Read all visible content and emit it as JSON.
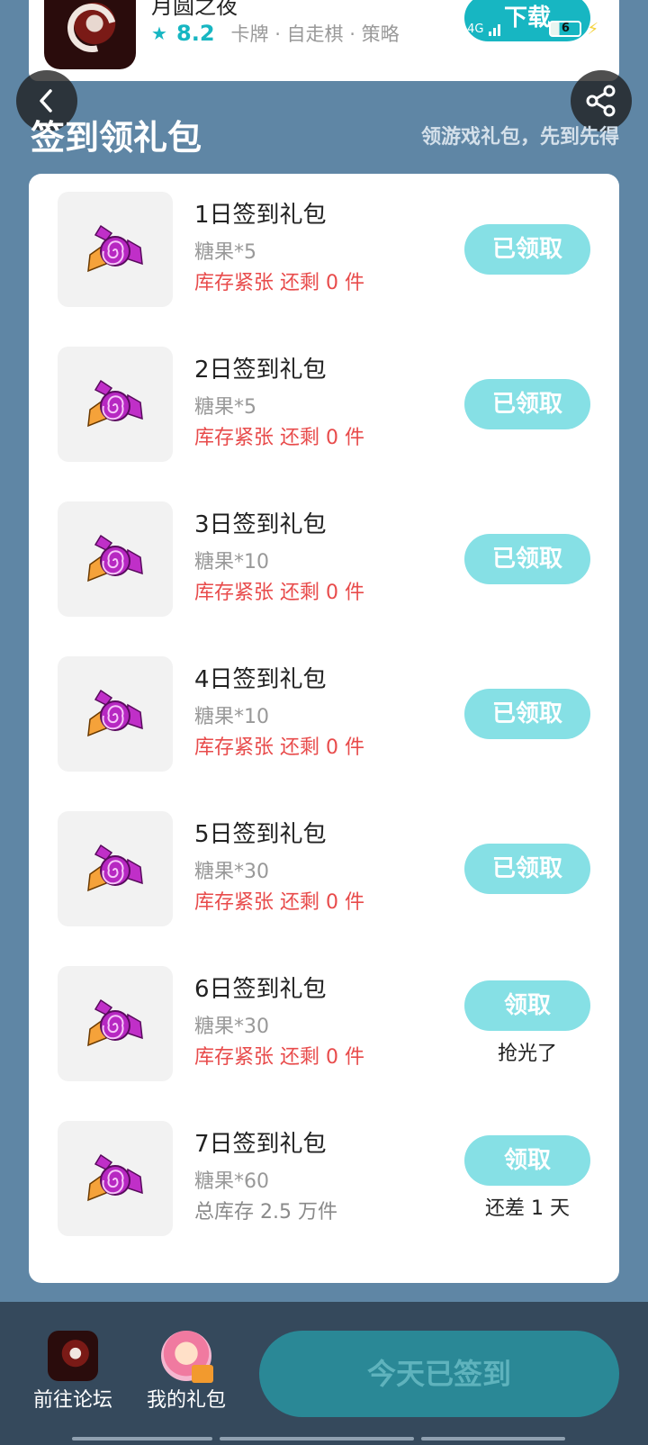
{
  "game": {
    "name": "月圆之夜",
    "rating": "8.2",
    "tags": "卡牌 · 自走棋 · 策略",
    "download_label": "下载"
  },
  "status_bar": {
    "network_1": "G",
    "network_2": "4G",
    "battery": "6"
  },
  "section": {
    "title": "签到领礼包",
    "subtitle": "领游戏礼包，先到先得"
  },
  "gifts": [
    {
      "name": "1日签到礼包",
      "content": "糖果*5",
      "stock": "库存紧张 还剩 0 件",
      "button": "已领取",
      "note": ""
    },
    {
      "name": "2日签到礼包",
      "content": "糖果*5",
      "stock": "库存紧张 还剩 0 件",
      "button": "已领取",
      "note": ""
    },
    {
      "name": "3日签到礼包",
      "content": "糖果*10",
      "stock": "库存紧张 还剩 0 件",
      "button": "已领取",
      "note": ""
    },
    {
      "name": "4日签到礼包",
      "content": "糖果*10",
      "stock": "库存紧张 还剩 0 件",
      "button": "已领取",
      "note": ""
    },
    {
      "name": "5日签到礼包",
      "content": "糖果*30",
      "stock": "库存紧张 还剩 0 件",
      "button": "已领取",
      "note": ""
    },
    {
      "name": "6日签到礼包",
      "content": "糖果*30",
      "stock": "库存紧张 还剩 0 件",
      "button": "领取",
      "note": "抢光了"
    },
    {
      "name": "7日签到礼包",
      "content": "糖果*60",
      "stock": "总库存 2.5 万件",
      "button": "领取",
      "note": "还差 1 天"
    }
  ],
  "bottom_bar": {
    "forum_label": "前往论坛",
    "mygift_label": "我的礼包",
    "signed_label": "今天已签到"
  },
  "colors": {
    "background": "#5f86a5",
    "accent": "#17b6c2",
    "button_disabled": "#86e0e5",
    "stock_warning": "#e84b4b",
    "bottom_bar": "#35495c"
  },
  "icons": [
    "game-icon",
    "star-icon",
    "back-icon",
    "share-icon",
    "candy-icon",
    "forum-icon",
    "gift-avatar-icon"
  ]
}
